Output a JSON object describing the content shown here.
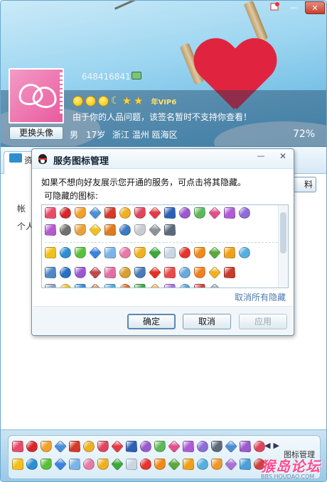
{
  "window": {
    "qq_number": "648416841",
    "signature": "由于你的人品问题，该签名暂时不支持你查看！",
    "change_avatar_label": "更换头像",
    "gender": "男",
    "age": "17岁",
    "location": "浙江 温州 瓯海区",
    "profile_percent": "72%",
    "tab_label": "资",
    "data_button_label": "料",
    "field_account": "帐",
    "field_personal": "个人",
    "vip_label": "年VIP6",
    "titlebar_min": "—",
    "titlebar_close": "✕"
  },
  "dialog": {
    "title": "服务图标管理",
    "min_label": "—",
    "close_label": "✕",
    "description": "如果不想向好友展示您开通的服务，可点击将其隐藏。",
    "subheading": "可隐藏的图标:",
    "cancel_all_label": "取消所有隐藏",
    "ok_label": "确定",
    "cancel_label": "取消",
    "apply_label": "应用"
  },
  "bottom_bar": {
    "manage_label": "图标管理",
    "watermark": "猴岛论坛",
    "watermark_sub": "BBS.HOUDAO.COM"
  },
  "icon_colors": {
    "row1": [
      "#e84a6a",
      "#d8262b",
      "#f2a02a",
      "#4a8fd6",
      "#d33a2a",
      "#f0b020",
      "#e0455d",
      "#e33a44",
      "#2c5fb5",
      "#9b59d0",
      "#5db85c",
      "#e54c8c",
      "#b05ad6",
      "#8d6cd8"
    ],
    "row2": [
      "#b45ad0",
      "#707070",
      "#e8a23a",
      "#f0c020",
      "#e07a1a",
      "#3a7ac6",
      "#c8ccd2",
      "#8c939a",
      "#5b6a7a"
    ],
    "row3": [
      "#f2c018",
      "#2d8fd2",
      "#5cbf3a",
      "#3b82e0",
      "#7ab4e8",
      "#e87aa8",
      "#f0b020",
      "#3aa83a",
      "#c9d6e4",
      "#e8342c",
      "#f08a1a",
      "#5aa83a",
      "#f0a018",
      "#55b0e0"
    ],
    "row4": [
      "#4f88c6",
      "#2a6fc6",
      "#9b59d0",
      "#c04848",
      "#e26fa3",
      "#d8a030",
      "#4a7ab8",
      "#e53020",
      "#e84a4a",
      "#6aa8e0",
      "#f08020",
      "#f0b020",
      "#c83a2a"
    ],
    "row5": [
      "#88a0b8",
      "#f0c020",
      "#3a88d0",
      "#c06030",
      "#58a8d8",
      "#e06a20",
      "#40a848",
      "#f09828",
      "#a870d8",
      "#4aa0d8",
      "#d04040",
      "#7a8a9a"
    ],
    "bottom1": [
      "#e84a6a",
      "#d8262b",
      "#f2a02a",
      "#4a8fd6",
      "#d33a2a",
      "#f0b020",
      "#e0455d",
      "#e33a44",
      "#2c5fb5",
      "#9b59d0",
      "#5db85c",
      "#e54c8c",
      "#b05ad6",
      "#8d6cd8",
      "#5b6a7a",
      "#4a8fd6",
      "#9b59d0",
      "#e0455d"
    ],
    "bottom2": [
      "#f2c018",
      "#2d8fd2",
      "#5cbf3a",
      "#3b82e0",
      "#7ab4e8",
      "#e87aa8",
      "#f0b020",
      "#3aa83a",
      "#c9d6e4",
      "#e8342c",
      "#f08a1a",
      "#5aa83a",
      "#f0a018",
      "#55b0e0",
      "#f09828",
      "#a870d8",
      "#4aa0d8",
      "#d04040"
    ]
  }
}
